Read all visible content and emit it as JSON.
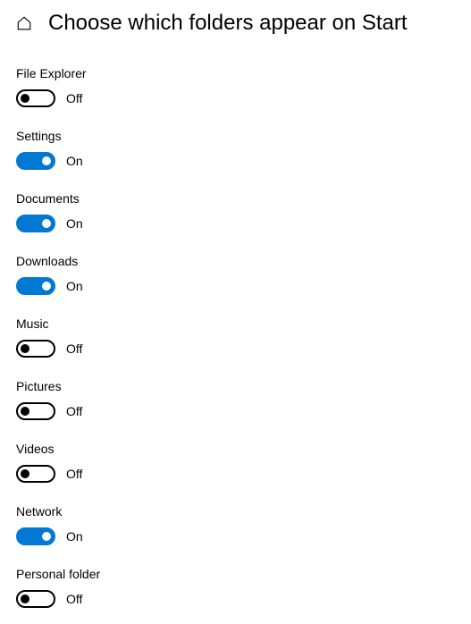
{
  "header": {
    "title": "Choose which folders appear on Start"
  },
  "labels": {
    "on": "On",
    "off": "Off"
  },
  "settings": [
    {
      "id": "file-explorer",
      "label": "File Explorer",
      "state": "off"
    },
    {
      "id": "settings",
      "label": "Settings",
      "state": "on"
    },
    {
      "id": "documents",
      "label": "Documents",
      "state": "on"
    },
    {
      "id": "downloads",
      "label": "Downloads",
      "state": "on"
    },
    {
      "id": "music",
      "label": "Music",
      "state": "off"
    },
    {
      "id": "pictures",
      "label": "Pictures",
      "state": "off"
    },
    {
      "id": "videos",
      "label": "Videos",
      "state": "off"
    },
    {
      "id": "network",
      "label": "Network",
      "state": "on"
    },
    {
      "id": "personal-folder",
      "label": "Personal folder",
      "state": "off"
    }
  ]
}
